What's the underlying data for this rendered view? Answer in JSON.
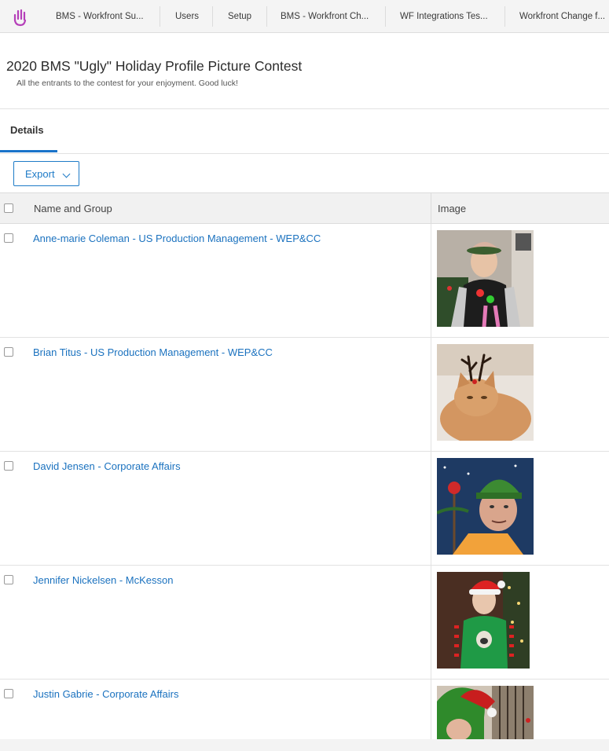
{
  "nav": {
    "tabs": [
      "BMS - Workfront Su...",
      "Users",
      "Setup",
      "BMS - Workfront Ch...",
      "WF Integrations Tes...",
      "Workfront Change f..."
    ],
    "logo_icon": "workfront-hand-logo",
    "logo_color": "#b53fb9"
  },
  "page": {
    "title": "2020 BMS \"Ugly\" Holiday Profile Picture Contest",
    "subtitle": "All the entrants to the contest for your enjoyment. Good luck!"
  },
  "tabs": {
    "details": "Details"
  },
  "toolbar": {
    "export_label": "Export"
  },
  "table": {
    "headers": {
      "name": "Name and Group",
      "image": "Image"
    },
    "rows": [
      {
        "name": "Anne-marie Coleman - US Production Management - WEP&CC",
        "image": "person-holiday-sweater-photo"
      },
      {
        "name": "Brian Titus - US Production Management - WEP&CC",
        "image": "cat-with-antlers-photo"
      },
      {
        "name": "David Jensen - Corporate Affairs",
        "image": "cartoon-elf-hat-photo"
      },
      {
        "name": "Jennifer Nickelsen - McKesson",
        "image": "person-santa-hat-photo"
      },
      {
        "name": "Justin Gabrie - Corporate Affairs",
        "image": "person-grinch-hat-photo"
      }
    ]
  },
  "colors": {
    "link": "#1b72bf",
    "accent": "#1a73c9"
  }
}
